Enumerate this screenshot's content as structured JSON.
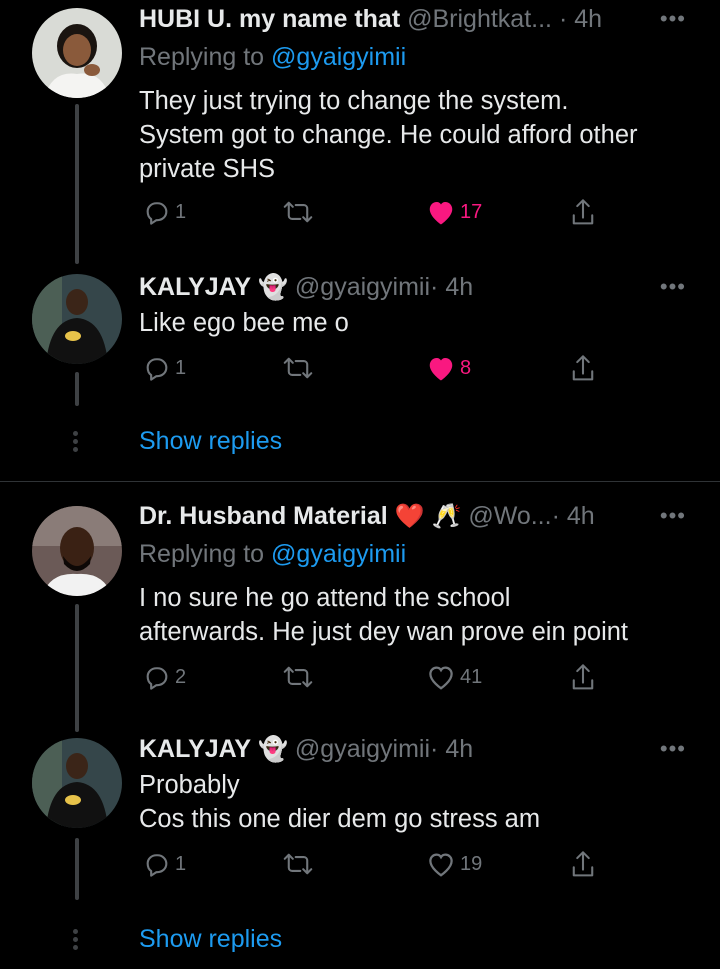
{
  "tweets": [
    {
      "name": "HUBI U. my name that",
      "handle": "@Brightkat...",
      "time": "· 4h",
      "replying_prefix": "Replying to ",
      "replying_to": "@gyaigyimii",
      "text": "They just trying to change the system.\nSystem got to change. He could afford other\nprivate SHS",
      "replies": "1",
      "retweets": "",
      "likes": "17",
      "liked": true
    },
    {
      "name": "KALYJAY",
      "emoji": "ghost",
      "handle": "@gyaigyimii",
      "time": "· 4h",
      "text": "Like ego bee me o",
      "replies": "1",
      "retweets": "",
      "likes": "8",
      "liked": true
    },
    {
      "name": "Dr. Husband Material",
      "emoji": "heart champagne",
      "handle": "@Wo...",
      "time": "· 4h",
      "replying_prefix": "Replying to ",
      "replying_to": "@gyaigyimii",
      "text": "I no sure he go attend the school\nafterwards. He just dey wan prove ein point",
      "replies": "2",
      "retweets": "",
      "likes": "41",
      "liked": false
    },
    {
      "name": "KALYJAY",
      "emoji": "ghost",
      "handle": "@gyaigyimii",
      "time": "· 4h",
      "text": "Probably\nCos this one dier dem go stress am",
      "replies": "1",
      "retweets": "",
      "likes": "19",
      "liked": false
    }
  ],
  "show_replies_1": "Show replies",
  "show_replies_2": "Show replies",
  "more_glyph": "•••",
  "colors": {
    "background": "#000000",
    "accent": "#1d9bf0",
    "like": "#f91880",
    "muted": "#71767b"
  }
}
